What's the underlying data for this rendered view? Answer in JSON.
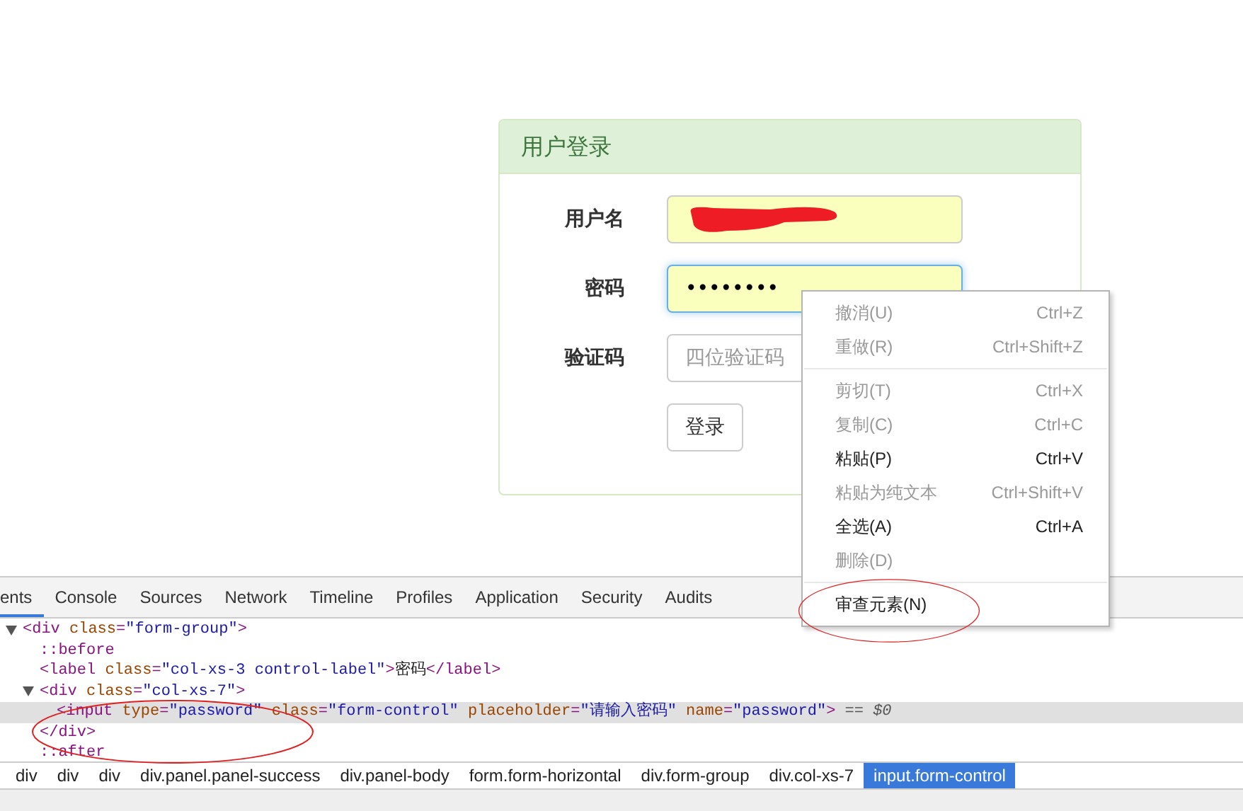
{
  "panel": {
    "title": "用户登录",
    "fields": [
      {
        "label": "用户名",
        "kind": "redacted",
        "focused": false
      },
      {
        "label": "密码",
        "kind": "password",
        "value": "••••••••",
        "focused": true
      },
      {
        "label": "验证码",
        "kind": "text",
        "placeholder": "四位验证码",
        "focused": false
      }
    ],
    "button": "登录"
  },
  "context_menu": [
    {
      "kind": "item",
      "label": "撤消(U)",
      "shortcut": "Ctrl+Z",
      "disabled": true
    },
    {
      "kind": "item",
      "label": "重做(R)",
      "shortcut": "Ctrl+Shift+Z",
      "disabled": true
    },
    {
      "kind": "separator"
    },
    {
      "kind": "item",
      "label": "剪切(T)",
      "shortcut": "Ctrl+X",
      "disabled": true
    },
    {
      "kind": "item",
      "label": "复制(C)",
      "shortcut": "Ctrl+C",
      "disabled": true
    },
    {
      "kind": "item",
      "label": "粘贴(P)",
      "shortcut": "Ctrl+V",
      "disabled": false
    },
    {
      "kind": "item",
      "label": "粘贴为纯文本",
      "shortcut": "Ctrl+Shift+V",
      "disabled": true
    },
    {
      "kind": "item",
      "label": "全选(A)",
      "shortcut": "Ctrl+A",
      "disabled": false
    },
    {
      "kind": "item",
      "label": "删除(D)",
      "disabled": true
    },
    {
      "kind": "separator"
    },
    {
      "kind": "item",
      "label": "审查元素(N)",
      "disabled": false
    }
  ],
  "devtools": {
    "tabs": [
      {
        "label": "ents",
        "selected": true
      },
      {
        "label": "Console",
        "selected": false
      },
      {
        "label": "Sources",
        "selected": false
      },
      {
        "label": "Network",
        "selected": false
      },
      {
        "label": "Timeline",
        "selected": false
      },
      {
        "label": "Profiles",
        "selected": false
      },
      {
        "label": "Application",
        "selected": false
      },
      {
        "label": "Security",
        "selected": false
      },
      {
        "label": "Audits",
        "selected": false
      }
    ],
    "dom_tree": [
      {
        "expanded": true,
        "selected": false,
        "tokens": [
          {
            "kind": "tag",
            "text": "<div"
          },
          {
            "kind": "attr",
            "text": " class"
          },
          {
            "kind": "tag",
            "text": "="
          },
          {
            "kind": "value",
            "text": "\"form-group\""
          },
          {
            "kind": "tag",
            "text": ">"
          }
        ],
        "children": [
          {
            "selected": false,
            "tokens": [
              {
                "kind": "tag",
                "text": "::before"
              }
            ]
          },
          {
            "selected": false,
            "tokens": [
              {
                "kind": "tag",
                "text": "<label"
              },
              {
                "kind": "attr",
                "text": " class"
              },
              {
                "kind": "tag",
                "text": "="
              },
              {
                "kind": "value",
                "text": "\"col-xs-3 control-label\""
              },
              {
                "kind": "tag",
                "text": ">"
              },
              {
                "kind": "text",
                "text": "密码"
              },
              {
                "kind": "tag",
                "text": "</label>"
              }
            ]
          },
          {
            "expanded": true,
            "selected": false,
            "tokens": [
              {
                "kind": "tag",
                "text": "<div"
              },
              {
                "kind": "attr",
                "text": " class"
              },
              {
                "kind": "tag",
                "text": "="
              },
              {
                "kind": "value",
                "text": "\"col-xs-7\""
              },
              {
                "kind": "tag",
                "text": ">"
              }
            ],
            "children": [
              {
                "selected": true,
                "tokens": [
                  {
                    "kind": "tag",
                    "text": "<input"
                  },
                  {
                    "kind": "attr",
                    "text": " type"
                  },
                  {
                    "kind": "tag",
                    "text": "="
                  },
                  {
                    "kind": "value",
                    "text": "\"password\""
                  },
                  {
                    "kind": "attr",
                    "text": " class"
                  },
                  {
                    "kind": "tag",
                    "text": "="
                  },
                  {
                    "kind": "value",
                    "text": "\"form-control\""
                  },
                  {
                    "kind": "attr",
                    "text": " placeholder"
                  },
                  {
                    "kind": "tag",
                    "text": "="
                  },
                  {
                    "kind": "value",
                    "text": "\"请输入密码\""
                  },
                  {
                    "kind": "attr",
                    "text": " name"
                  },
                  {
                    "kind": "tag",
                    "text": "="
                  },
                  {
                    "kind": "value",
                    "text": "\"password\""
                  },
                  {
                    "kind": "tag",
                    "text": ">"
                  },
                  {
                    "kind": "meta",
                    "text": " == $0"
                  }
                ]
              }
            ],
            "close": [
              {
                "kind": "tag",
                "text": "</div>"
              }
            ]
          },
          {
            "selected": false,
            "tokens": [
              {
                "kind": "tag",
                "text": "::after"
              }
            ]
          }
        ]
      }
    ],
    "breadcrumbs": [
      {
        "label": "div",
        "selected": false
      },
      {
        "label": "div",
        "selected": false
      },
      {
        "label": "div",
        "selected": false
      },
      {
        "label": "div.panel.panel-success",
        "selected": false
      },
      {
        "label": "div.panel-body",
        "selected": false
      },
      {
        "label": "form.form-horizontal",
        "selected": false
      },
      {
        "label": "div.form-group",
        "selected": false
      },
      {
        "label": "div.col-xs-7",
        "selected": false
      },
      {
        "label": "input.form-control",
        "selected": true
      }
    ]
  }
}
